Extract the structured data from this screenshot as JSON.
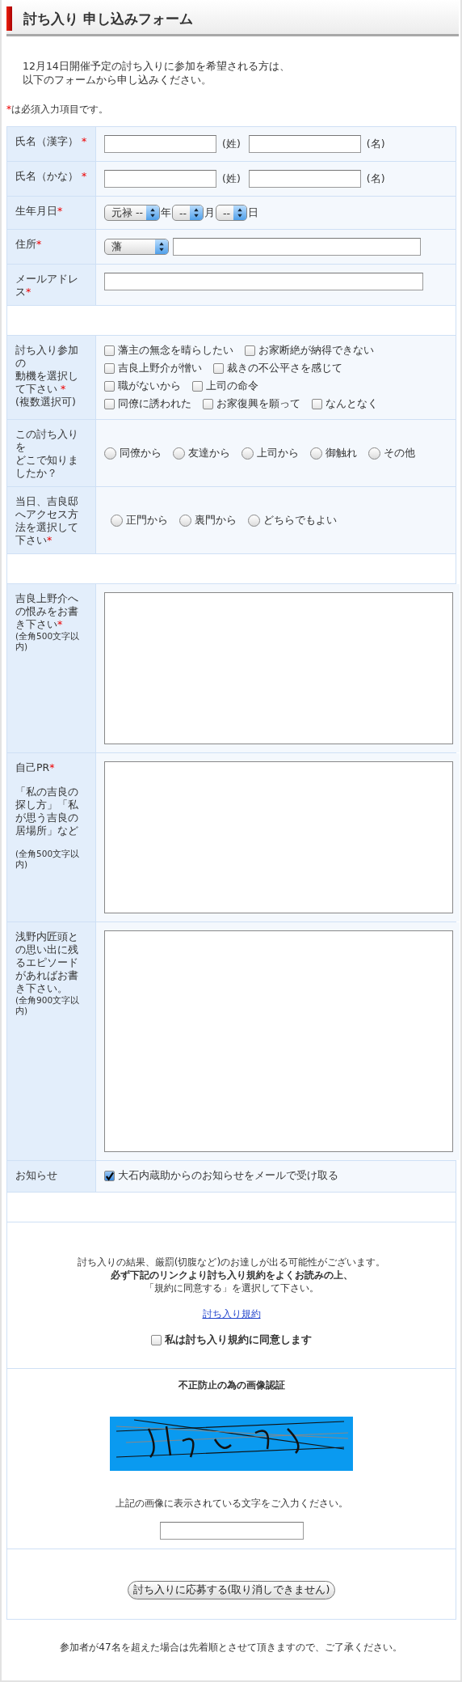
{
  "title": "討ち入り 申し込みフォーム",
  "intro": [
    "12月14日開催予定の討ち入りに参加を希望される方は、",
    "以下のフォームから申し込みください。"
  ],
  "required_note": {
    "mark": "*",
    "text": "は必須入力項目です。"
  },
  "rows": [
    {
      "kind": "name",
      "label": "氏名（漢字）",
      "mark": " *",
      "inputs": [
        {
          "suffix": "(姓)"
        },
        {
          "suffix": "(名)"
        }
      ]
    },
    {
      "kind": "name",
      "label": "氏名（かな）",
      "mark": " *",
      "inputs": [
        {
          "suffix": "(姓)"
        },
        {
          "suffix": "(名)"
        }
      ]
    },
    {
      "kind": "birthdate",
      "label": "生年月日",
      "mark": "*",
      "selects": [
        {
          "value": "元禄 --",
          "unit": "年"
        },
        {
          "value": "--",
          "unit": "月"
        },
        {
          "value": "--",
          "unit": "日"
        }
      ]
    },
    {
      "kind": "address",
      "label": "住所",
      "mark": "*",
      "selects": [
        {
          "value": "藩"
        }
      ]
    },
    {
      "kind": "email",
      "label": "メールアドレス",
      "mark": "*"
    },
    {
      "kind": "spacer"
    },
    {
      "kind": "checkboxes",
      "label": [
        "討ち入り参加の",
        "動機を選択して下さい"
      ],
      "mark": " *",
      "description": "(複数選択可)",
      "option_rows": [
        [
          {
            "label": "藩主の無念を晴らしたい",
            "checked": false
          },
          {
            "label": "お家断絶が納得できない",
            "checked": false
          }
        ],
        [
          {
            "label": "吉良上野介が憎い",
            "checked": false
          },
          {
            "label": "裁きの不公平さを感じて",
            "checked": false
          }
        ],
        [
          {
            "label": "職がないから",
            "checked": false
          },
          {
            "label": "上司の命令",
            "checked": false
          }
        ],
        [
          {
            "label": "同僚に誘われた",
            "checked": false
          },
          {
            "label": "お家復興を願って",
            "checked": false
          },
          {
            "label": "なんとなく",
            "checked": false
          }
        ]
      ]
    },
    {
      "kind": "radios",
      "label": [
        "この討ち入りを",
        "どこで知りましたか？"
      ],
      "indent": false,
      "options": [
        {
          "label": "同僚から",
          "selected": false
        },
        {
          "label": "友達から",
          "selected": false
        },
        {
          "label": "上司から",
          "selected": false
        },
        {
          "label": "御触れ",
          "selected": false
        },
        {
          "label": "その他",
          "selected": false
        }
      ]
    },
    {
      "kind": "radios",
      "label": "当日、吉良邸へアクセス方法を選択して下さい",
      "mark": "*",
      "indent": true,
      "options": [
        {
          "label": "正門から",
          "selected": false
        },
        {
          "label": "裏門から",
          "selected": false
        },
        {
          "label": "どちらでもよい",
          "selected": false
        }
      ]
    },
    {
      "kind": "spacer"
    },
    {
      "kind": "textarea",
      "label": "吉良上野介への恨みをお書き下さい",
      "mark": "*",
      "limit": "(全角500文字以内)"
    },
    {
      "kind": "textarea",
      "label": "自己PR",
      "mark": "*",
      "description": "「私の吉良の探し方」「私が思う吉良の居場所」など",
      "limit": "(全角500文字以内)"
    },
    {
      "kind": "textarea",
      "label": "浅野内匠頭との思い出に残るエピソードがあればお書き下さい。",
      "limit": "(全角900文字以内)"
    },
    {
      "kind": "notice",
      "label": "お知らせ",
      "option": {
        "label": "大石内蔵助からのお知らせをメールで受け取る",
        "checked": true
      }
    },
    {
      "kind": "spacer"
    }
  ],
  "agreement": {
    "lines": [
      "討ち入りの結果、厳罰(切腹など)のお達しが出る可能性がございます。",
      "**必ず下記のリンクより討ち入り規約をよくお読みの上、**",
      "「規約に同意する」を選択して下さい。"
    ],
    "link": "討ち入り規約",
    "consent": {
      "label": "私は討ち入り規約に同意します",
      "checked": false
    }
  },
  "captcha": {
    "title": "不正防止の為の画像認証",
    "instruction": "上記の画像に表示されている文字をご入力ください。"
  },
  "submit": "討ち入りに応募する(取り消しできません)",
  "footer": "参加者が47名を超えた場合は先着順とさせて頂きますので、ご了承ください。"
}
